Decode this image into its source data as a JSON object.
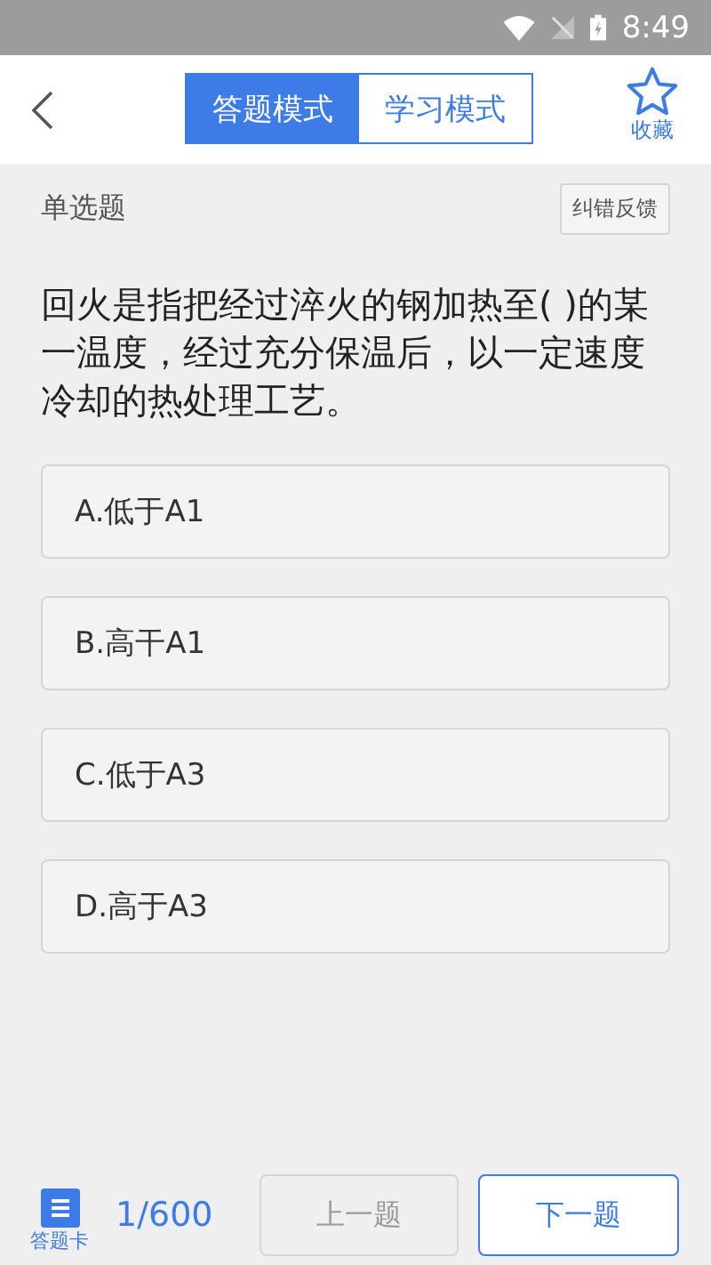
{
  "status_bar": {
    "time": "8:49"
  },
  "header": {
    "tabs": [
      {
        "label": "答题模式",
        "selected": true
      },
      {
        "label": "学习模式",
        "selected": false
      }
    ],
    "favorite_label": "收藏"
  },
  "question": {
    "type_label": "单选题",
    "feedback_button": "纠错反馈",
    "text": "回火是指把经过淬火的钢加热至( )的某一温度，经过充分保温后，以一定速度冷却的热处理工艺。"
  },
  "options": [
    {
      "label": "A.低于A1",
      "selected": false
    },
    {
      "label": "B.高干A1",
      "selected": false
    },
    {
      "label": "C.低于A3",
      "selected": false
    },
    {
      "label": "D.高于A3",
      "selected": false
    }
  ],
  "footer": {
    "card_label": "答题卡",
    "progress": "1/600",
    "prev_button": {
      "label": "上一题",
      "disabled": true
    },
    "next_button": {
      "label": "下一题",
      "disabled": false
    }
  }
}
